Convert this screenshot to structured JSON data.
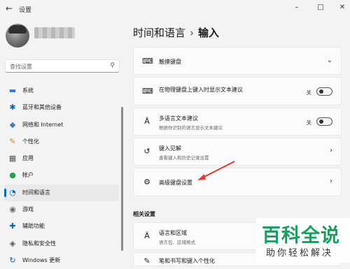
{
  "window": {
    "title": "设置",
    "back": "←",
    "minimize": "–",
    "maximize": "□",
    "close": "✕"
  },
  "search": {
    "placeholder": "查找设置"
  },
  "nav": [
    {
      "label": "系统",
      "icon": "monitor-icon",
      "glyph": "▬",
      "color": "#3a7bd5"
    },
    {
      "label": "蓝牙和其他设备",
      "icon": "bluetooth-icon",
      "glyph": "✱",
      "color": "#0067c0"
    },
    {
      "label": "网络和 Internet",
      "icon": "wifi-icon",
      "glyph": "◆",
      "color": "#3a7bd5"
    },
    {
      "label": "个性化",
      "icon": "brush-icon",
      "glyph": "✎",
      "color": "#d27d2d"
    },
    {
      "label": "应用",
      "icon": "apps-icon",
      "glyph": "▦",
      "color": "#555"
    },
    {
      "label": "帐户",
      "icon": "person-icon",
      "glyph": "●",
      "color": "#1ea34b"
    },
    {
      "label": "时间和语言",
      "icon": "globe-clock-icon",
      "glyph": "◔",
      "color": "#0067c0",
      "active": true
    },
    {
      "label": "游戏",
      "icon": "gamepad-icon",
      "glyph": "◉",
      "color": "#666"
    },
    {
      "label": "辅助功能",
      "icon": "accessibility-icon",
      "glyph": "✚",
      "color": "#0067c0"
    },
    {
      "label": "隐私和安全性",
      "icon": "shield-icon",
      "glyph": "◈",
      "color": "#555"
    },
    {
      "label": "Windows 更新",
      "icon": "update-icon",
      "glyph": "↻",
      "color": "#0067c0"
    }
  ],
  "breadcrumb": {
    "parent": "时间和语言",
    "sep": "›",
    "current": "输入"
  },
  "cards": {
    "touch_keyboard": {
      "title": "触摸键盘"
    },
    "suggestions": {
      "title": "在物理键盘上键入时显示文本建议",
      "state": "关"
    },
    "multilingual": {
      "title": "多语言文本建议",
      "subtitle": "根据你识别的语言显示文本建议",
      "state": "关"
    },
    "insights": {
      "title": "键入见解",
      "subtitle": "查看键入和历史记录设置"
    },
    "advanced": {
      "title": "高级键盘设置"
    }
  },
  "section": {
    "title": "相关设置"
  },
  "related": {
    "language": {
      "title": "语言和区域",
      "subtitle": "语言包、区域格式"
    },
    "pen": {
      "title": "笔和书写和键入个性化"
    }
  },
  "watermark": {
    "main": "百科全说",
    "sub": "助你轻松解决"
  },
  "colors": {
    "accent": "#0067c0",
    "arrow": "#e8382f",
    "watermark": "#17a05d"
  }
}
